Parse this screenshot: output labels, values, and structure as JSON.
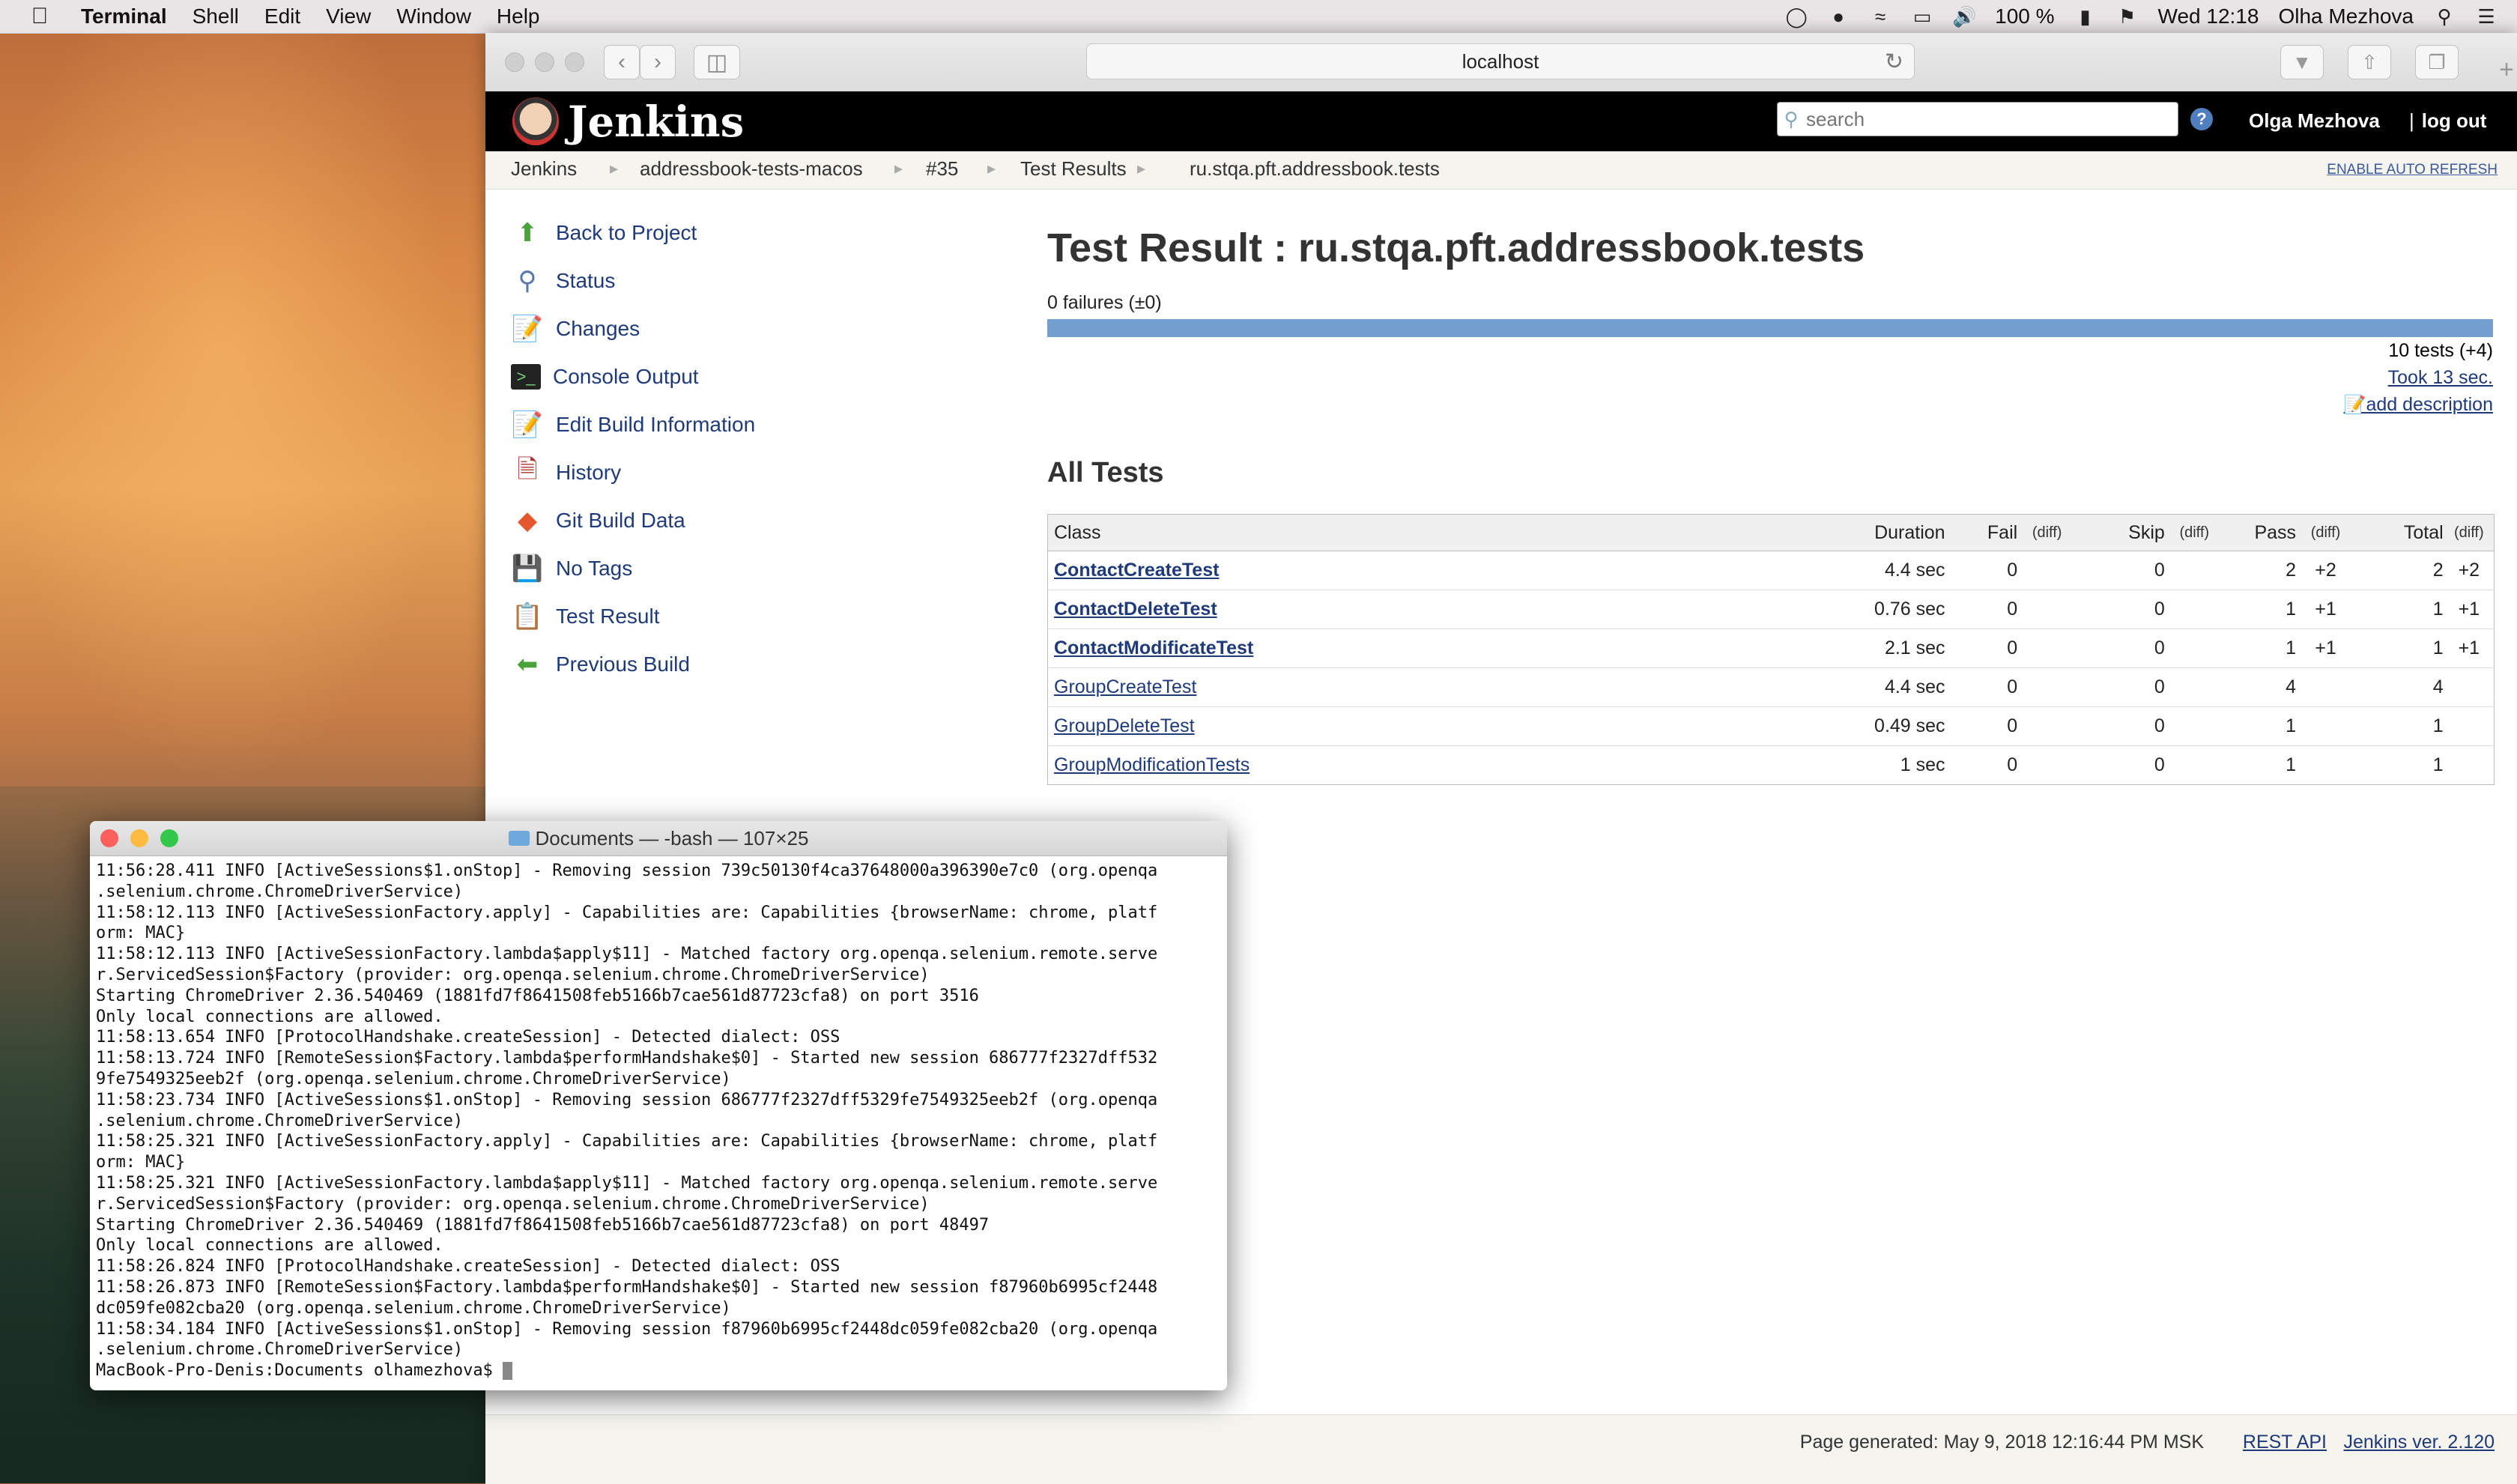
{
  "menubar": {
    "app": "Terminal",
    "items": [
      "Shell",
      "Edit",
      "View",
      "Window",
      "Help"
    ],
    "battery": "100 %",
    "clock": "Wed 12:18",
    "user": "Olha Mezhova"
  },
  "browser": {
    "url": "localhost"
  },
  "jenkins": {
    "logo_text": "Jenkins",
    "search_placeholder": "search",
    "help": "?",
    "user": "Olga Mezhova",
    "logout": "log out",
    "logout_sep": "|",
    "breadcrumbs": [
      "Jenkins",
      "addressbook-tests-macos",
      "#35",
      "Test Results",
      "ru.stqa.pft.addressbook.tests"
    ],
    "auto_refresh": "ENABLE AUTO REFRESH",
    "sidebar": [
      {
        "label": "Back to Project",
        "icon": "up-arrow-icon"
      },
      {
        "label": "Status",
        "icon": "magnifier-icon"
      },
      {
        "label": "Changes",
        "icon": "notepad-icon"
      },
      {
        "label": "Console Output",
        "icon": "terminal-icon"
      },
      {
        "label": "Edit Build Information",
        "icon": "notepad-edit-icon"
      },
      {
        "label": "History",
        "icon": "history-icon"
      },
      {
        "label": "Git Build Data",
        "icon": "git-icon"
      },
      {
        "label": "No Tags",
        "icon": "save-disk-icon"
      },
      {
        "label": "Test Result",
        "icon": "clipboard-icon"
      },
      {
        "label": "Previous Build",
        "icon": "left-arrow-icon"
      }
    ],
    "title": "Test Result : ru.stqa.pft.addressbook.tests",
    "failures": "0 failures (±0)",
    "pass_fraction": 1.0,
    "tests_count": "10 tests (+4)",
    "took": "Took 13 sec.",
    "add_description": "add description",
    "all_tests": "All Tests",
    "columns": {
      "class": "Class",
      "duration": "Duration",
      "fail": "Fail",
      "skip": "Skip",
      "pass": "Pass",
      "total": "Total",
      "diff": "(diff)"
    },
    "rows": [
      {
        "class": "ContactCreateTest",
        "duration": "4.4 sec",
        "fail": "0",
        "fail_diff": "",
        "skip": "0",
        "skip_diff": "",
        "pass": "2",
        "pass_diff": "+2",
        "total": "2",
        "total_diff": "+2",
        "bold": true
      },
      {
        "class": "ContactDeleteTest",
        "duration": "0.76 sec",
        "fail": "0",
        "fail_diff": "",
        "skip": "0",
        "skip_diff": "",
        "pass": "1",
        "pass_diff": "+1",
        "total": "1",
        "total_diff": "+1",
        "bold": true
      },
      {
        "class": "ContactModificateTest",
        "duration": "2.1 sec",
        "fail": "0",
        "fail_diff": "",
        "skip": "0",
        "skip_diff": "",
        "pass": "1",
        "pass_diff": "+1",
        "total": "1",
        "total_diff": "+1",
        "bold": true
      },
      {
        "class": "GroupCreateTest",
        "duration": "4.4 sec",
        "fail": "0",
        "fail_diff": "",
        "skip": "0",
        "skip_diff": "",
        "pass": "4",
        "pass_diff": "",
        "total": "4",
        "total_diff": "",
        "bold": false
      },
      {
        "class": "GroupDeleteTest",
        "duration": "0.49 sec",
        "fail": "0",
        "fail_diff": "",
        "skip": "0",
        "skip_diff": "",
        "pass": "1",
        "pass_diff": "",
        "total": "1",
        "total_diff": "",
        "bold": false
      },
      {
        "class": "GroupModificationTests",
        "duration": "1 sec",
        "fail": "0",
        "fail_diff": "",
        "skip": "0",
        "skip_diff": "",
        "pass": "1",
        "pass_diff": "",
        "total": "1",
        "total_diff": "",
        "bold": false
      }
    ],
    "footer": {
      "generated": "Page generated: May 9, 2018 12:16:44 PM MSK",
      "rest_api": "REST API",
      "version": "Jenkins ver. 2.120"
    }
  },
  "terminal": {
    "title": "Documents — -bash — 107×25",
    "lines": [
      "11:56:28.411 INFO [ActiveSessions$1.onStop] - Removing session 739c50130f4ca37648000a396390e7c0 (org.openqa",
      ".selenium.chrome.ChromeDriverService)",
      "11:58:12.113 INFO [ActiveSessionFactory.apply] - Capabilities are: Capabilities {browserName: chrome, platf",
      "orm: MAC}",
      "11:58:12.113 INFO [ActiveSessionFactory.lambda$apply$11] - Matched factory org.openqa.selenium.remote.serve",
      "r.ServicedSession$Factory (provider: org.openqa.selenium.chrome.ChromeDriverService)",
      "Starting ChromeDriver 2.36.540469 (1881fd7f8641508feb5166b7cae561d87723cfa8) on port 3516",
      "Only local connections are allowed.",
      "11:58:13.654 INFO [ProtocolHandshake.createSession] - Detected dialect: OSS",
      "11:58:13.724 INFO [RemoteSession$Factory.lambda$performHandshake$0] - Started new session 686777f2327dff532",
      "9fe7549325eeb2f (org.openqa.selenium.chrome.ChromeDriverService)",
      "11:58:23.734 INFO [ActiveSessions$1.onStop] - Removing session 686777f2327dff5329fe7549325eeb2f (org.openqa",
      ".selenium.chrome.ChromeDriverService)",
      "11:58:25.321 INFO [ActiveSessionFactory.apply] - Capabilities are: Capabilities {browserName: chrome, platf",
      "orm: MAC}",
      "11:58:25.321 INFO [ActiveSessionFactory.lambda$apply$11] - Matched factory org.openqa.selenium.remote.serve",
      "r.ServicedSession$Factory (provider: org.openqa.selenium.chrome.ChromeDriverService)",
      "Starting ChromeDriver 2.36.540469 (1881fd7f8641508feb5166b7cae561d87723cfa8) on port 48497",
      "Only local connections are allowed.",
      "11:58:26.824 INFO [ProtocolHandshake.createSession] - Detected dialect: OSS",
      "11:58:26.873 INFO [RemoteSession$Factory.lambda$performHandshake$0] - Started new session f87960b6995cf2448",
      "dc059fe082cba20 (org.openqa.selenium.chrome.ChromeDriverService)",
      "11:58:34.184 INFO [ActiveSessions$1.onStop] - Removing session f87960b6995cf2448dc059fe082cba20 (org.openqa",
      ".selenium.chrome.ChromeDriverService)"
    ],
    "prompt": "MacBook-Pro-Denis:Documents olhamezhova$ "
  },
  "colors": {
    "jenkins_link": "#1f3a7a",
    "progress_pass": "#729fcf",
    "close": "#fc605c",
    "minimize": "#fdbc40",
    "zoom": "#34c84a"
  }
}
